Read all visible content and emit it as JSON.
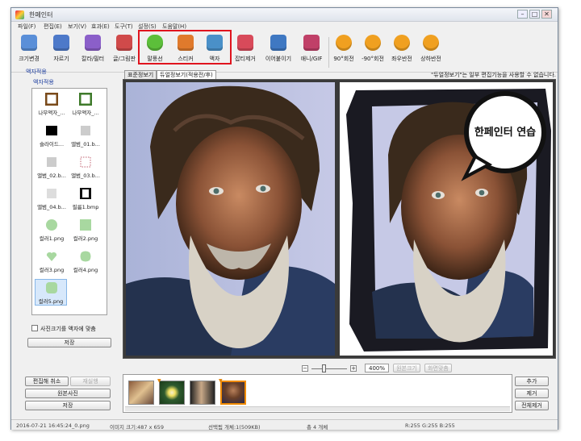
{
  "window": {
    "title": "한페인터"
  },
  "menu": [
    "파일(F)",
    "편집(E)",
    "보기(V)",
    "효과(E)",
    "도구(T)",
    "설정(S)",
    "도움말(H)"
  ],
  "toolbar": [
    {
      "label": "크기변경",
      "icon": "resize-icon",
      "color": "#5a8fd8"
    },
    {
      "label": "자르기",
      "icon": "crop-icon",
      "color": "#4d79c9"
    },
    {
      "label": "칼라/필터",
      "icon": "color-filter-icon",
      "color": "#8b5fc9"
    },
    {
      "label": "글/그림판",
      "icon": "text-draw-icon",
      "color": "#d04a4a"
    },
    {
      "label": "말풍선",
      "icon": "speech-bubble-icon",
      "color": "#5cbf3a"
    },
    {
      "label": "스티커",
      "icon": "sticker-icon",
      "color": "#e07a2c"
    },
    {
      "label": "액자",
      "icon": "frame-icon",
      "color": "#4a90c8"
    },
    {
      "label": "잡티제거",
      "icon": "blemish-remove-icon",
      "color": "#d84a5a"
    },
    {
      "label": "이어붙이기",
      "icon": "join-icon",
      "color": "#3f78c2"
    },
    {
      "label": "애니/GIF",
      "icon": "gif-icon",
      "color": "#c04068"
    },
    {
      "label": "90°회전",
      "icon": "rotate-right-icon",
      "color": "#f0a020"
    },
    {
      "label": "-90°회전",
      "icon": "rotate-left-icon",
      "color": "#f0a020"
    },
    {
      "label": "좌우반전",
      "icon": "flip-horizontal-icon",
      "color": "#f0a020"
    },
    {
      "label": "상하반전",
      "icon": "flip-vertical-icon",
      "color": "#f0a020"
    }
  ],
  "left_panel": {
    "title": "액자적용",
    "subtitle": "액자적용",
    "files": [
      {
        "name": "나무액자_...",
        "thumb": "wood-frame"
      },
      {
        "name": "나무액자_...",
        "thumb": "green-wood-frame"
      },
      {
        "name": "슬라이드...",
        "thumb": "black-square"
      },
      {
        "name": "앨범_01.b...",
        "thumb": "grey-square"
      },
      {
        "name": "앨범_02.b...",
        "thumb": "grey-square"
      },
      {
        "name": "앨범_03.b...",
        "thumb": "dashed-square"
      },
      {
        "name": "앨범_04.b...",
        "thumb": "grey-square"
      },
      {
        "name": "필름1.bmp",
        "thumb": "film-frame"
      },
      {
        "name": "컬러1.png",
        "thumb": "green-circle"
      },
      {
        "name": "컬러2.png",
        "thumb": "green-square"
      },
      {
        "name": "컬러3.png",
        "thumb": "green-heart"
      },
      {
        "name": "컬러4.png",
        "thumb": "green-blob"
      },
      {
        "name": "컬러5.png",
        "thumb": "green-rounded"
      }
    ],
    "selected_index": 12,
    "checkbox_label": "사진크기를 액자에 맞춤",
    "apply_button": "저장"
  },
  "view": {
    "tabs": [
      "표준정보기",
      "듀얼정보기(적용전/후)"
    ],
    "active_tab": 1,
    "notice": "\"듀얼정보기\"는 일부 편집기능을 사용할 수 없습니다.",
    "bubble_text": "한페인터 연습"
  },
  "zoom": {
    "value": "400%",
    "fit_label": "원본크기",
    "window_label": "화면맞춤",
    "level": 0.35
  },
  "bottom_left": {
    "undo": "편집해 취소",
    "redo": "재실행",
    "original": "원본사진",
    "save": "저장"
  },
  "bottom_right": {
    "add": "추가",
    "remove": "제거",
    "remove_all": "전체제거"
  },
  "thumbnails": [
    {
      "kind": "couple-photo",
      "marked": false
    },
    {
      "kind": "flower-photo",
      "marked": true
    },
    {
      "kind": "portrait-photo",
      "marked": false
    },
    {
      "kind": "old-man-photo",
      "marked": true
    }
  ],
  "selected_thumbnail": 3,
  "status": {
    "file": "2016-07-21 16:45:24_0.png",
    "size": "이미지 크기:487 x 659",
    "selected": "선택됨 개체:1(509KB)",
    "total": "총 4 개체",
    "rgb": "R:255 G:255 B:255"
  }
}
